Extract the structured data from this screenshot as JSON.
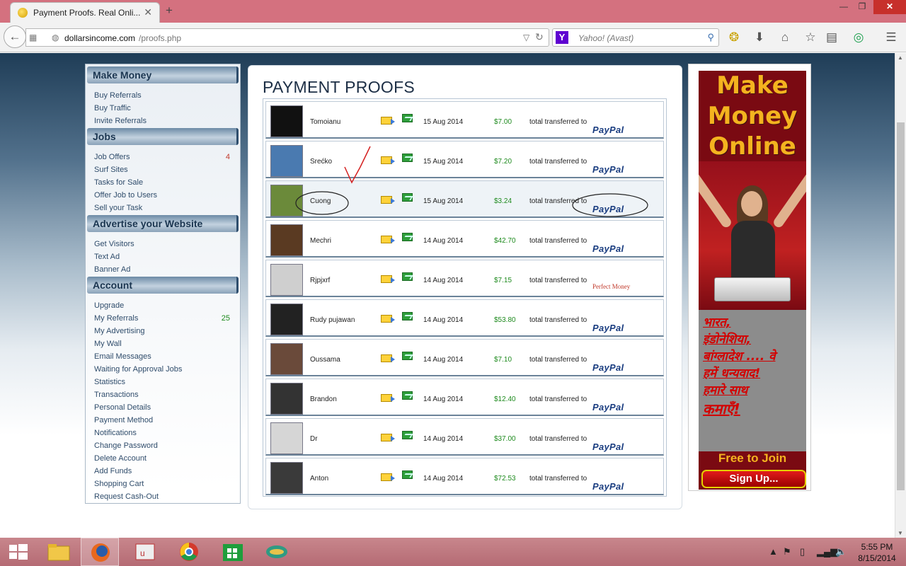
{
  "browser": {
    "tab_title": "Payment Proofs. Real Onli...",
    "url_domain": "dollarsincome.com",
    "url_path": "/proofs.php",
    "search_placeholder": "Yahoo! (Avast)",
    "search_engine_letter": "Y"
  },
  "sidebar": {
    "make_money": {
      "title": "Make Money",
      "items": [
        "Buy Referrals",
        "Buy Traffic",
        "Invite Referrals"
      ]
    },
    "jobs": {
      "title": "Jobs",
      "items": [
        "Job Offers",
        "Surf Sites",
        "Tasks for Sale",
        "Offer Job to Users",
        "Sell your Task"
      ],
      "job_offers_count": "4"
    },
    "advertise": {
      "title": "Advertise your Website",
      "items": [
        "Get Visitors",
        "Text Ad",
        "Banner Ad"
      ]
    },
    "account": {
      "title": "Account",
      "items": [
        "Upgrade",
        "My Referrals",
        "My Advertising",
        "My Wall",
        "Email Messages",
        "Waiting for Approval Jobs",
        "Statistics",
        "Transactions",
        "Personal Details",
        "Payment Method",
        "Notifications",
        "Change Password",
        "Delete Account",
        "Add Funds",
        "Shopping Cart",
        "Request Cash-Out"
      ],
      "referrals_count": "25"
    }
  },
  "main": {
    "title": "PAYMENT PROOFS",
    "transfer_label": "total transferred to",
    "proofs": [
      {
        "user": "Tomoianu",
        "date": "15 Aug 2014",
        "amount": "$7.00",
        "method": "PayPal"
      },
      {
        "user": "Srećko",
        "date": "15 Aug 2014",
        "amount": "$7.20",
        "method": "PayPal"
      },
      {
        "user": "Cuong",
        "date": "15 Aug 2014",
        "amount": "$3.24",
        "method": "PayPal"
      },
      {
        "user": "Mechri",
        "date": "14 Aug 2014",
        "amount": "$42.70",
        "method": "PayPal"
      },
      {
        "user": "Rjpjxrf",
        "date": "14 Aug 2014",
        "amount": "$7.15",
        "method": "Perfect Money"
      },
      {
        "user": "Rudy pujawan",
        "date": "14 Aug 2014",
        "amount": "$53.80",
        "method": "PayPal"
      },
      {
        "user": "Oussama",
        "date": "14 Aug 2014",
        "amount": "$7.10",
        "method": "PayPal"
      },
      {
        "user": "Brandon",
        "date": "14 Aug 2014",
        "amount": "$12.40",
        "method": "PayPal"
      },
      {
        "user": "Dr",
        "date": "14 Aug 2014",
        "amount": "$37.00",
        "method": "PayPal"
      },
      {
        "user": "Anton",
        "date": "14 Aug 2014",
        "amount": "$72.53",
        "method": "PayPal"
      }
    ]
  },
  "banner": {
    "headline_1": "Make",
    "headline_2": "Money",
    "headline_3": "Online",
    "hindi_1": "भारत,",
    "hindi_2": "इंडोनेशिया,",
    "hindi_3": "बांग्लादेश .... वे",
    "hindi_4": "हमें धन्यवाद!",
    "hindi_5": "हमारे साथ",
    "hindi_6": "कमाएँ!",
    "free": "Free to Join",
    "signup": "Sign Up..."
  },
  "taskbar": {
    "time": "5:55 PM",
    "date": "8/15/2014"
  },
  "colors": {
    "title_bar": "#d4717f",
    "amount_green": "#1d8a1d",
    "count_red": "#c0392b",
    "paypal_blue": "#1a3d80",
    "banner_bg": "#7a0a12",
    "banner_gold": "#f4b31f"
  }
}
